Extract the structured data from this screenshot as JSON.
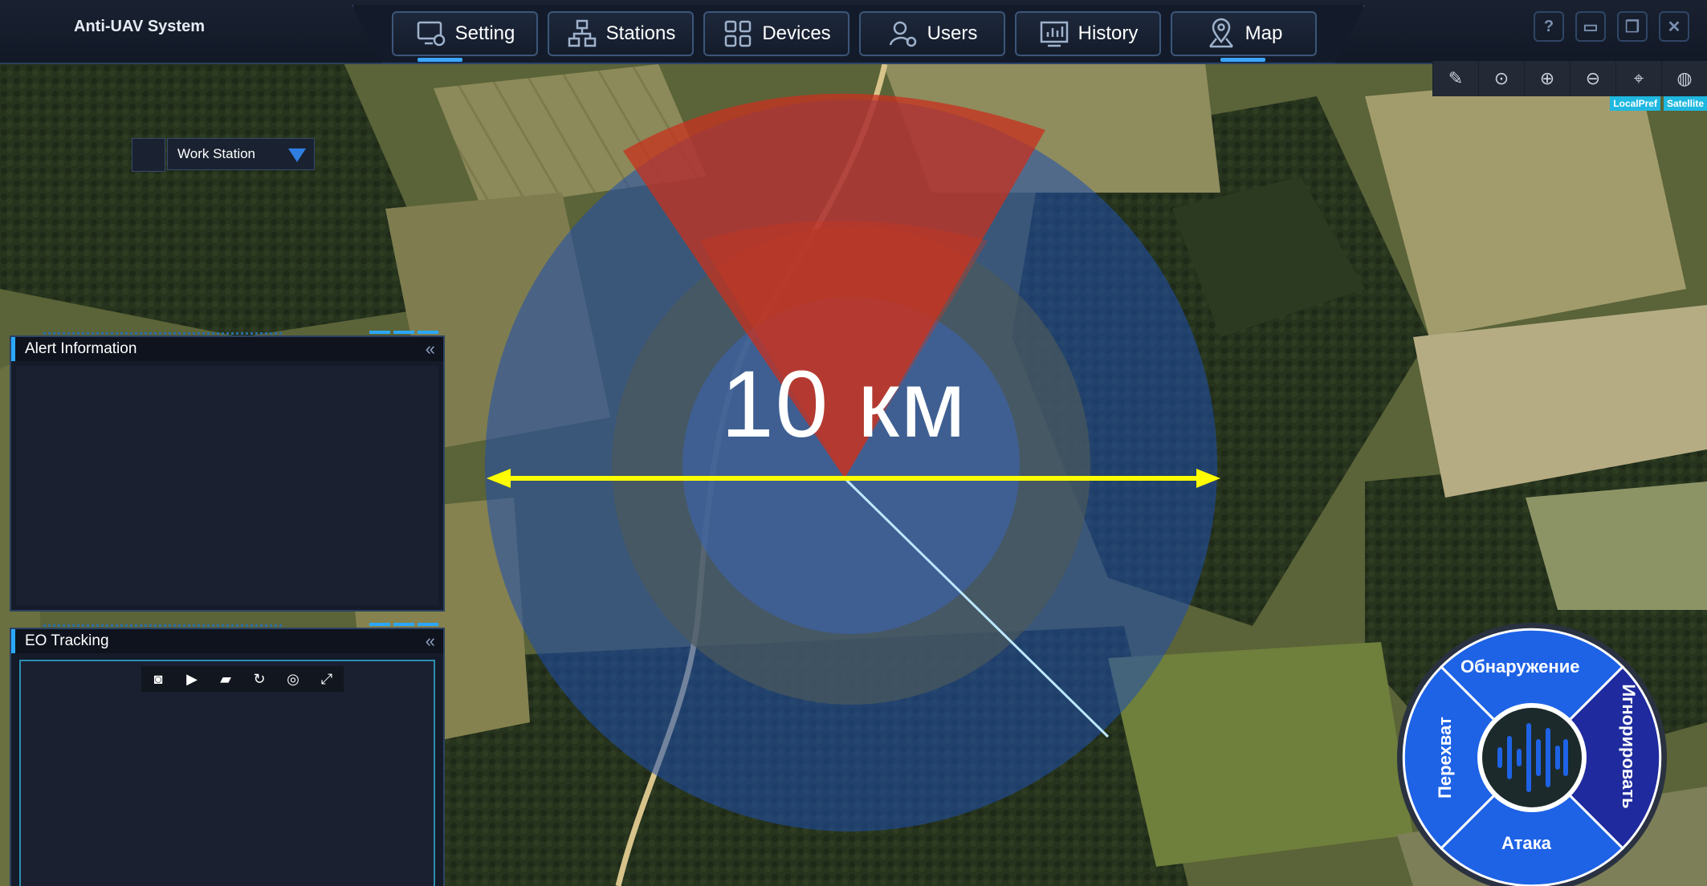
{
  "app": {
    "title": "Anti-UAV System"
  },
  "nav": {
    "setting": "Setting",
    "stations": "Stations",
    "devices": "Devices",
    "users": "Users",
    "history": "History",
    "map": "Map"
  },
  "window_controls": [
    "?",
    "▭",
    "❐",
    "✕"
  ],
  "map_tools": {
    "icons": [
      "pencil-icon",
      "circle-target-icon",
      "zoom-in-icon",
      "zoom-out-icon",
      "pin-icon",
      "globe-icon"
    ],
    "tags": {
      "local": "LocalPref",
      "satellite": "Satellite"
    }
  },
  "work_station": {
    "selected": "Work Station"
  },
  "panels": {
    "alert": {
      "title": "Alert Information"
    },
    "eo": {
      "title": "EO Tracking"
    }
  },
  "eo_tools": [
    "camera-icon",
    "video-icon",
    "folder-icon",
    "refresh-icon",
    "target-icon",
    "fullscreen-icon"
  ],
  "overlay": {
    "range_label": "10 км"
  },
  "wheel": {
    "top": "Обнаружение",
    "right": "Игнорировать",
    "bottom": "Атака",
    "left": "Перехват"
  },
  "colors": {
    "accent": "#2aa8ff",
    "wheel_blue": "#1e63e6",
    "wheel_dark": "#1f2a9e",
    "sector_red": "#c8301e",
    "ring_blue": "#1f4fae",
    "arrow_yellow": "#ffff00"
  }
}
